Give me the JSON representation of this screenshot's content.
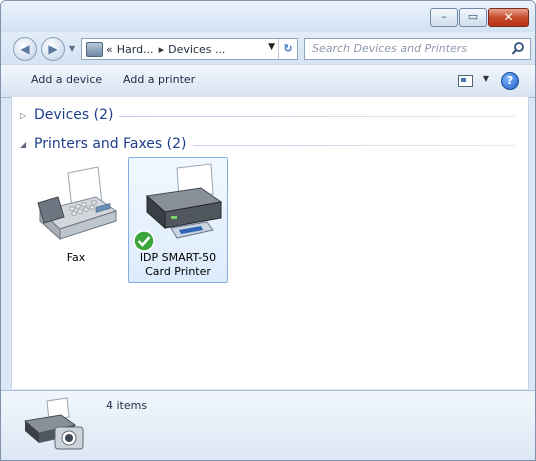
{
  "window": {
    "minimize_glyph": "–",
    "maximize_glyph": "▭",
    "close_glyph": "✕"
  },
  "nav": {
    "back_glyph": "◀",
    "forward_glyph": "▶",
    "breadcrumbs": [
      "«",
      "Hard...",
      "Devices ..."
    ],
    "separator": "▸",
    "refresh_glyph": "↻"
  },
  "search": {
    "placeholder": "Search Devices and Printers",
    "icon": "search-icon"
  },
  "toolbar": {
    "add_device": "Add a device",
    "add_printer": "Add a printer",
    "help_glyph": "?"
  },
  "groups": [
    {
      "label": "Devices (2)",
      "expanded": false
    },
    {
      "label": "Printers and Faxes (2)",
      "expanded": true
    }
  ],
  "devices": [
    {
      "label": "Fax",
      "icon": "fax-icon",
      "selected": false,
      "default": false
    },
    {
      "label": "IDP SMART-50 Card Printer",
      "icon": "printer-icon",
      "selected": true,
      "default": true
    }
  ],
  "status": {
    "text": "4 items",
    "icon": "printer-camera-icon"
  },
  "colors": {
    "group_label": "#1e3e8c",
    "close_button": "#c64a2c",
    "default_check": "#3aa53a"
  }
}
